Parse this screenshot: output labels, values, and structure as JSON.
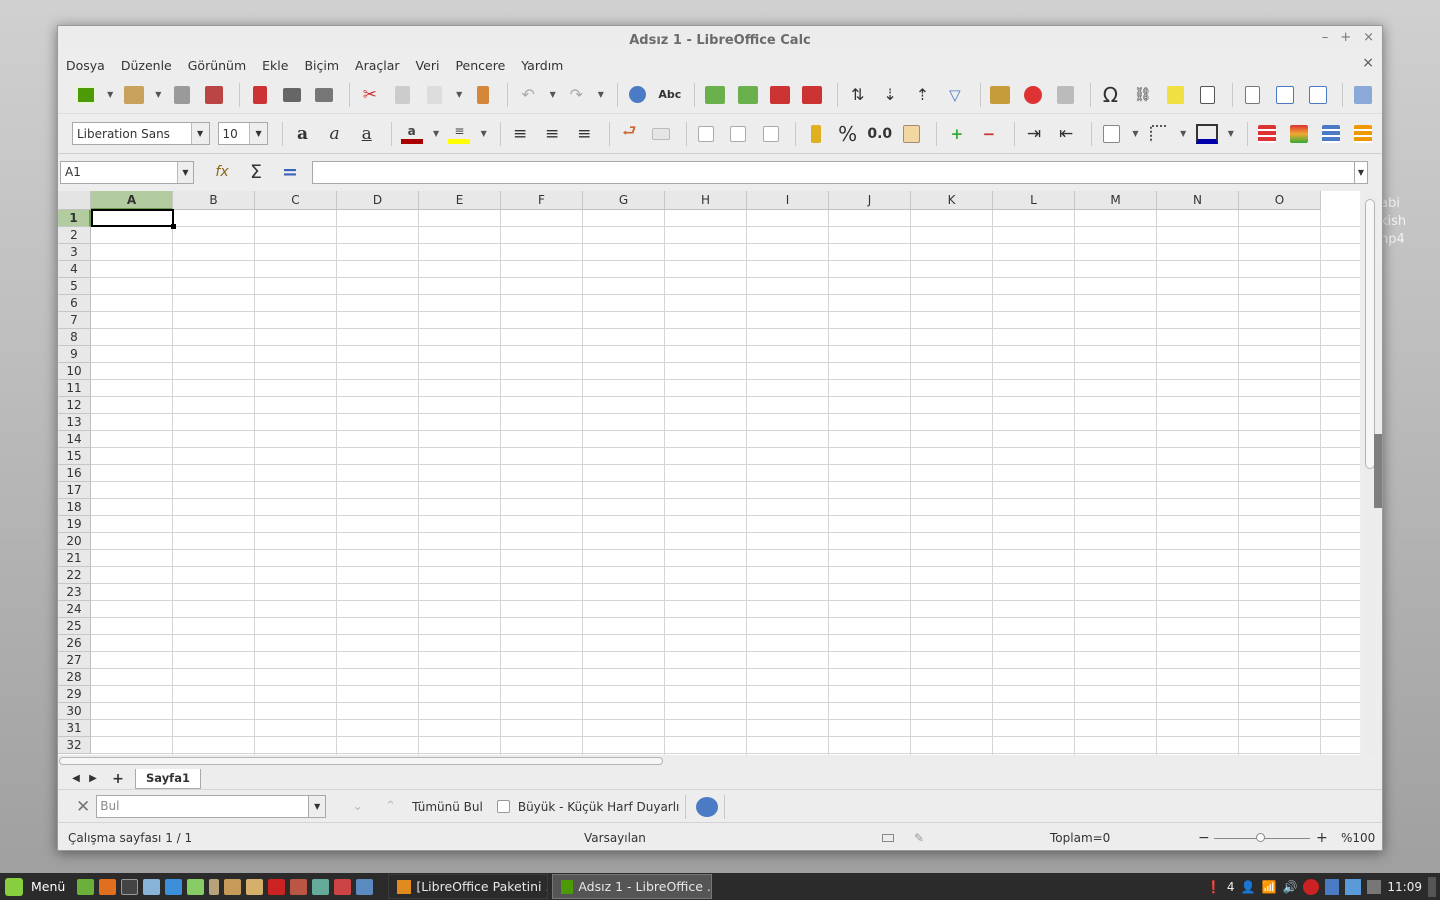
{
  "desktop": {
    "ghost_labels": [
      "abi",
      "kish",
      "np4"
    ]
  },
  "window": {
    "title": "Adsız 1 - LibreOffice Calc",
    "controls": [
      "–",
      "+",
      "×"
    ]
  },
  "menubar": {
    "items": [
      "Dosya",
      "Düzenle",
      "Görünüm",
      "Ekle",
      "Biçim",
      "Araçlar",
      "Veri",
      "Pencere",
      "Yardım"
    ],
    "close": "×"
  },
  "formatting": {
    "font_name": "Liberation Sans",
    "font_size": "10",
    "percent": "%",
    "decimal": "0.0"
  },
  "formula": {
    "cell_ref": "A1",
    "sum": "Σ",
    "equals": "=",
    "fx": "fx"
  },
  "sheet": {
    "columns": [
      "A",
      "B",
      "C",
      "D",
      "E",
      "F",
      "G",
      "H",
      "I",
      "J",
      "K",
      "L",
      "M",
      "N",
      "O"
    ],
    "rows": [
      "1",
      "2",
      "3",
      "4",
      "5",
      "6",
      "7",
      "8",
      "9",
      "10",
      "11",
      "12",
      "13",
      "14",
      "15",
      "16",
      "17",
      "18",
      "19",
      "20",
      "21",
      "22",
      "23",
      "24",
      "25",
      "26",
      "27",
      "28",
      "29",
      "30",
      "31",
      "32"
    ],
    "selected_cell": "A1",
    "tab": "Sayfa1"
  },
  "findbar": {
    "placeholder": "Bul",
    "find_all": "Tümünü Bul",
    "match_case": "Büyük - Küçük Harf Duyarlı"
  },
  "statusbar": {
    "sheet": "Çalışma sayfası 1 / 1",
    "style": "Varsayılan",
    "sum": "Toplam=0",
    "zoom": "%100"
  },
  "taskbar": {
    "menu": "Menü",
    "tasks": [
      "[LibreOffice Paketini ...",
      "Adsız 1 - LibreOffice ..."
    ],
    "workspace": "4",
    "clock": "11:09"
  },
  "colors": {
    "accent": "#6a9a4e",
    "selected_header": "#b2cca0",
    "taskbar": "#2b2b2b",
    "mint": "#87cf3e"
  }
}
